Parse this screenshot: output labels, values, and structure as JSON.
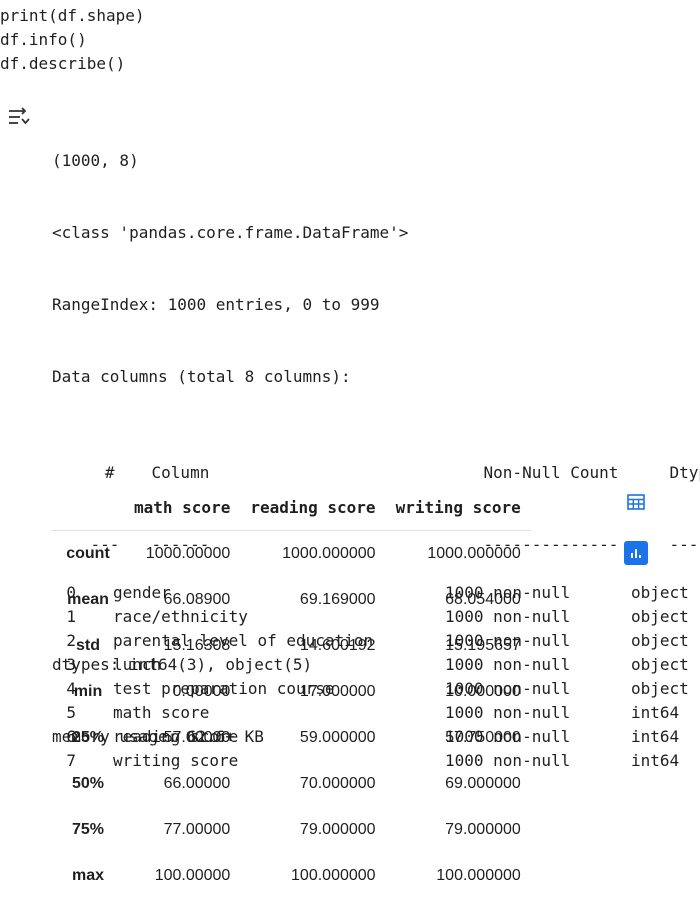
{
  "code": {
    "lines": [
      "print(df.shape)",
      "df.info()",
      "df.describe()"
    ]
  },
  "output": {
    "shape": "(1000, 8)",
    "class_line": "<class 'pandas.core.frame.DataFrame'>",
    "range_index": "RangeIndex: 1000 entries, 0 to 999",
    "data_columns": "Data columns (total 8 columns):",
    "info_header": {
      "num": "#",
      "column": "Column",
      "nonnull": "Non-Null Count",
      "dtype": "Dtype"
    },
    "info_separator": {
      "num": "---",
      "column": "------",
      "nonnull": "--------------",
      "dtype": "-----"
    },
    "info_rows": [
      {
        "num": "0",
        "column": "gender",
        "nonnull": "1000 non-null",
        "dtype": "object"
      },
      {
        "num": "1",
        "column": "race/ethnicity",
        "nonnull": "1000 non-null",
        "dtype": "object"
      },
      {
        "num": "2",
        "column": "parental level of education",
        "nonnull": "1000 non-null",
        "dtype": "object"
      },
      {
        "num": "3",
        "column": "lunch",
        "nonnull": "1000 non-null",
        "dtype": "object"
      },
      {
        "num": "4",
        "column": "test preparation course",
        "nonnull": "1000 non-null",
        "dtype": "object"
      },
      {
        "num": "5",
        "column": "math score",
        "nonnull": "1000 non-null",
        "dtype": "int64"
      },
      {
        "num": "6",
        "column": "reading score",
        "nonnull": "1000 non-null",
        "dtype": "int64"
      },
      {
        "num": "7",
        "column": "writing score",
        "nonnull": "1000 non-null",
        "dtype": "int64"
      }
    ],
    "dtypes_line": "dtypes: int64(3), object(5)",
    "memory_line": "memory usage: 62.6+ KB"
  },
  "describe": {
    "columns": [
      "math score",
      "reading score",
      "writing score"
    ],
    "rows": [
      {
        "label": "count",
        "values": [
          "1000.00000",
          "1000.000000",
          "1000.000000"
        ]
      },
      {
        "label": "mean",
        "values": [
          "66.08900",
          "69.169000",
          "68.054000"
        ]
      },
      {
        "label": "std",
        "values": [
          "15.16308",
          "14.600192",
          "15.195657"
        ]
      },
      {
        "label": "min",
        "values": [
          "0.00000",
          "17.000000",
          "10.000000"
        ]
      },
      {
        "label": "25%",
        "values": [
          "57.00000",
          "59.000000",
          "57.750000"
        ]
      },
      {
        "label": "50%",
        "values": [
          "66.00000",
          "70.000000",
          "69.000000"
        ]
      },
      {
        "label": "75%",
        "values": [
          "77.00000",
          "79.000000",
          "79.000000"
        ]
      },
      {
        "label": "max",
        "values": [
          "100.00000",
          "100.000000",
          "100.000000"
        ]
      }
    ]
  },
  "icons": {
    "output_toggle": "output-collapse-icon",
    "table_view": "table-view-icon",
    "chart_suggest": "bar-chart-icon"
  },
  "colors": {
    "accent": "#1a73e8"
  }
}
